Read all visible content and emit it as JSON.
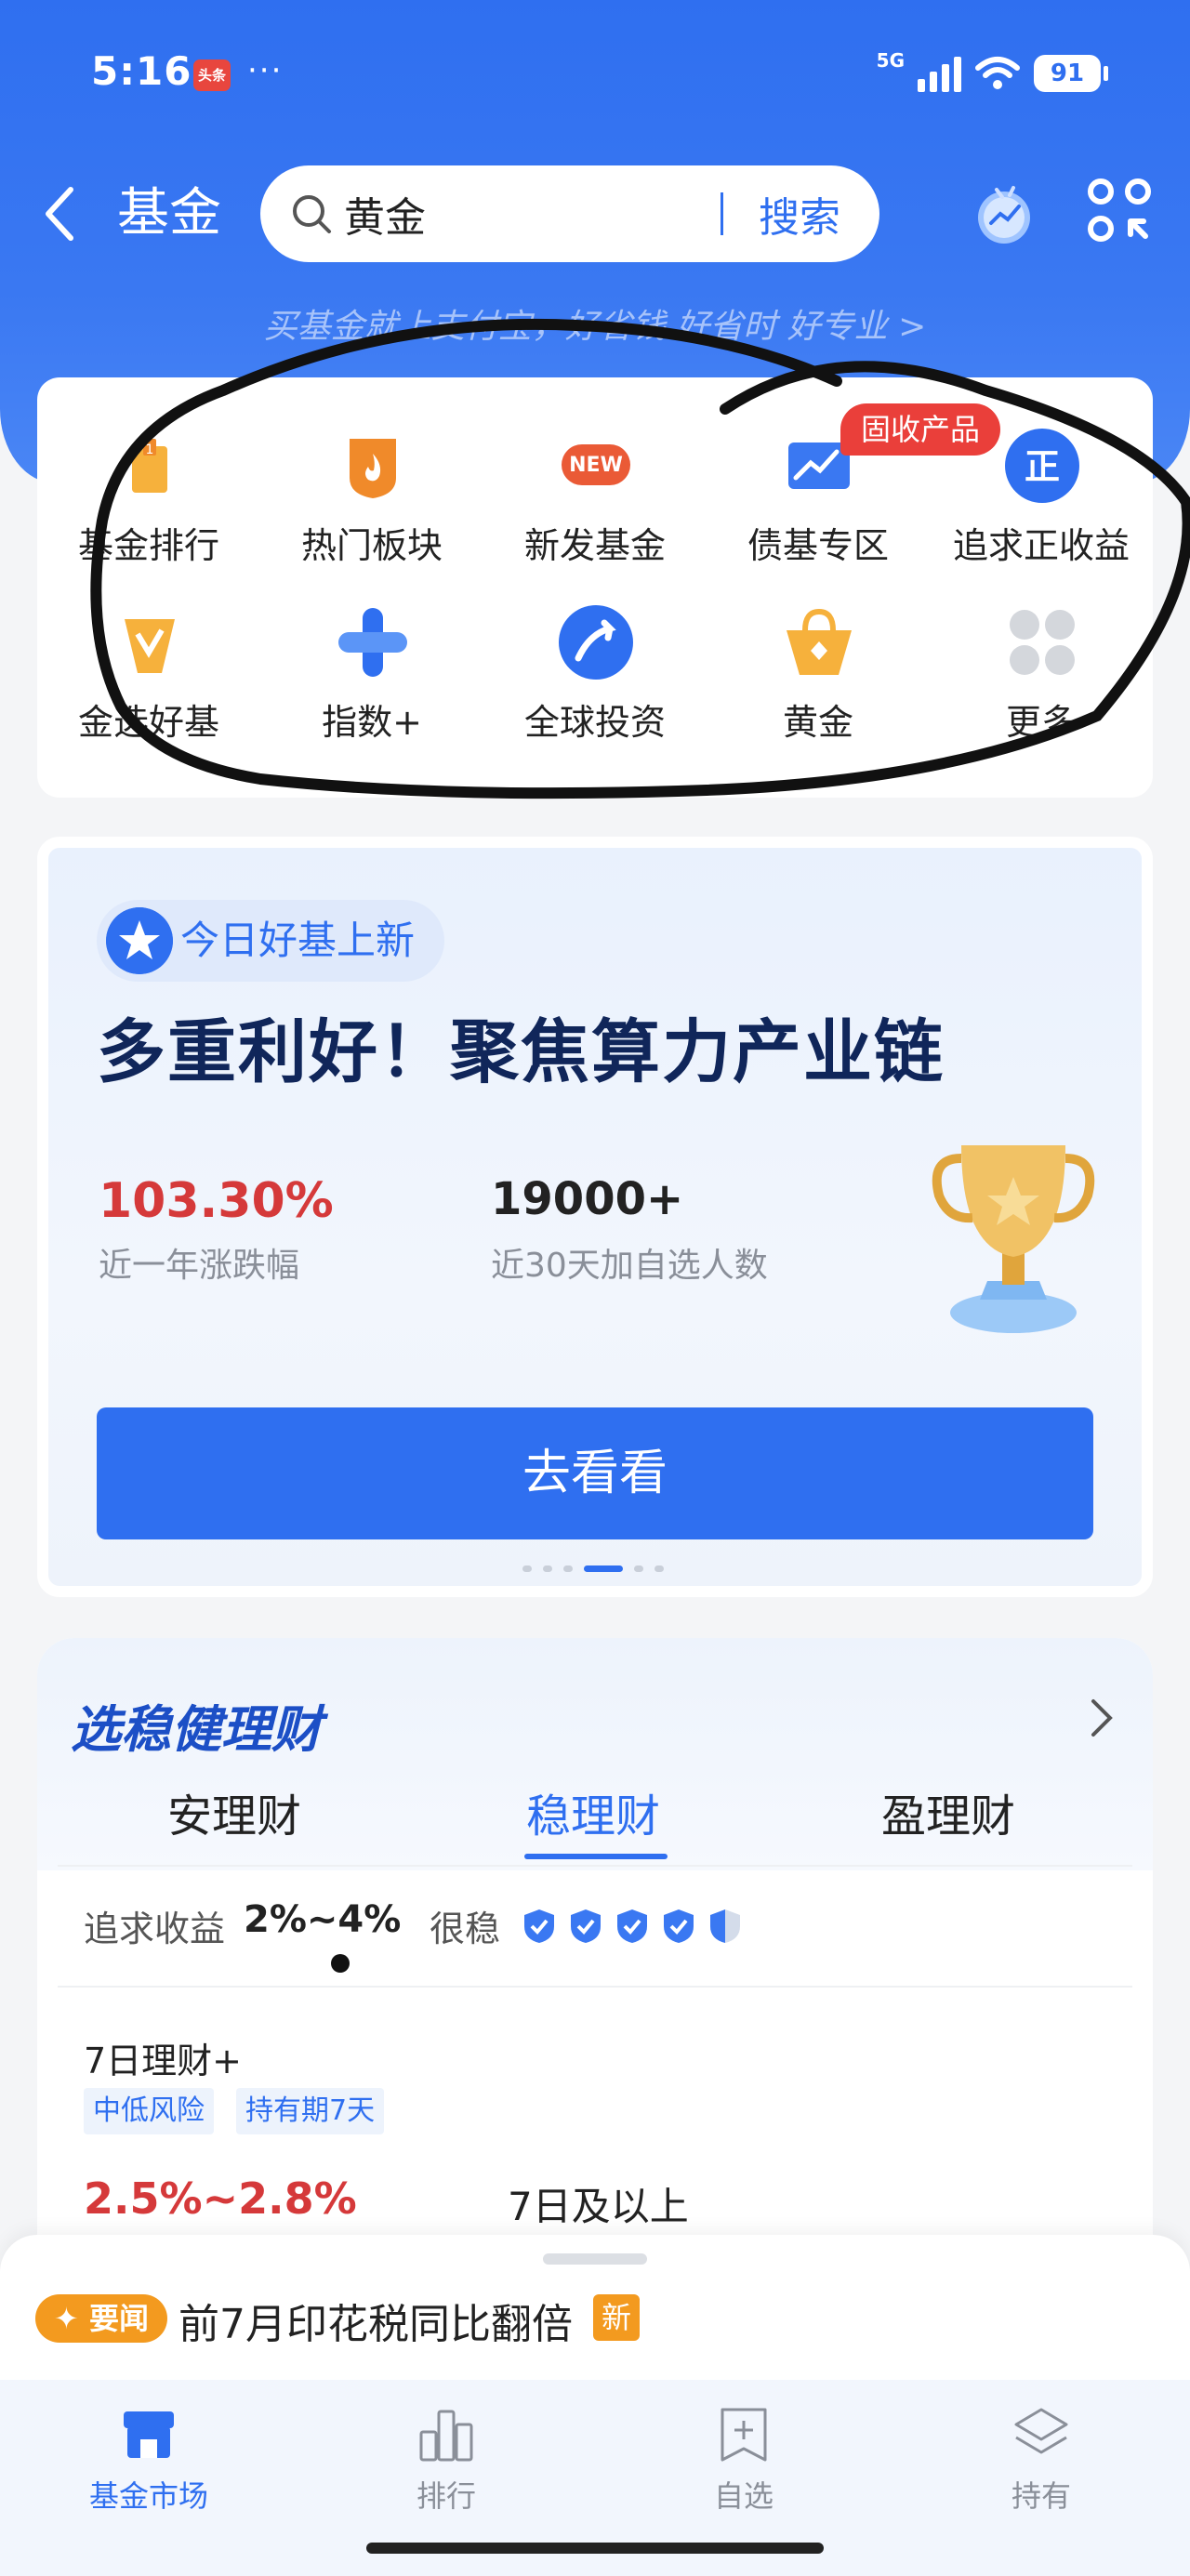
{
  "status_bar": {
    "time": "5:16",
    "news_app_label": "头条",
    "overflow": "···",
    "network": "5G",
    "battery": "91"
  },
  "header": {
    "title": "基金",
    "search_value": "黄金",
    "search_button": "搜索",
    "slogan": "买基金就上支付宝，好省钱 好省时 好专业 >"
  },
  "categories": {
    "badge": "固收产品",
    "items": [
      {
        "label": "基金排行",
        "icon": "ranking-icon"
      },
      {
        "label": "热门板块",
        "icon": "fire-icon"
      },
      {
        "label": "新发基金",
        "icon": "new-icon"
      },
      {
        "label": "债基专区",
        "icon": "bond-chart-icon"
      },
      {
        "label": "追求正收益",
        "icon": "positive-return-icon"
      },
      {
        "label": "金选好基",
        "icon": "gold-select-icon"
      },
      {
        "label": "指数+",
        "icon": "index-plus-icon"
      },
      {
        "label": "全球投资",
        "icon": "global-invest-icon"
      },
      {
        "label": "黄金",
        "icon": "gold-bag-icon"
      },
      {
        "label": "更多",
        "icon": "more-grid-icon"
      }
    ]
  },
  "feature": {
    "tag": "今日好基上新",
    "title": "多重利好！聚焦算力产业链",
    "stat1_value": "103.30%",
    "stat1_label": "近一年涨跌幅",
    "stat2_value": "19000+",
    "stat2_label": "近30天加自选人数",
    "cta": "去看看",
    "carousel_active_index": 3,
    "carousel_count": 6
  },
  "wealth": {
    "title": "选稳健理财",
    "tabs": [
      "安理财",
      "稳理财",
      "盈理财"
    ],
    "active_tab": "稳理财",
    "yield_label": "追求收益",
    "yield_value": "2%~4%",
    "stability_label": "很稳",
    "stability_level": 4.5,
    "fund_name": "7日理财+",
    "fund_tags": [
      "中低风险",
      "持有期7天"
    ],
    "fund_rate": "2.5%~2.8%",
    "fund_period": "7日及以上"
  },
  "news": {
    "badge": "要闻",
    "text": "前7月印花税同比翻倍",
    "new_label": "新"
  },
  "tab_bar": {
    "items": [
      {
        "label": "基金市场",
        "icon": "market-icon",
        "active": true
      },
      {
        "label": "排行",
        "icon": "ranking-bars-icon",
        "active": false
      },
      {
        "label": "自选",
        "icon": "watchlist-icon",
        "active": false
      },
      {
        "label": "持有",
        "icon": "holdings-icon",
        "active": false
      }
    ]
  },
  "colors": {
    "primary": "#2f6ff0",
    "rise": "#d5393a",
    "badge_red": "#ea3f3a",
    "orange": "#f39a1f"
  }
}
